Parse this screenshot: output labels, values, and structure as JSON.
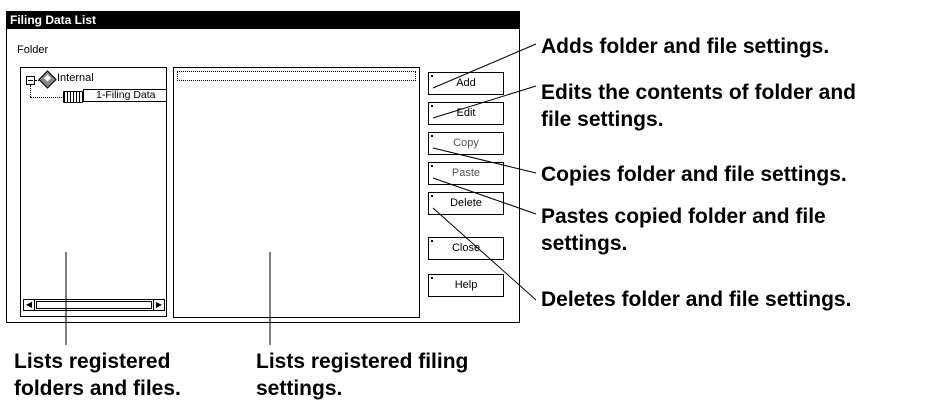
{
  "dialog": {
    "title": "Filing Data List",
    "folder_label": "Folder",
    "tree": {
      "root_label": "Internal",
      "child_label": "1-Filing Data"
    },
    "buttons": {
      "add": "Add",
      "edit": "Edit",
      "copy": "Copy",
      "paste": "Paste",
      "delete": "Delete",
      "close": "Close",
      "help": "Help"
    }
  },
  "callouts": {
    "add": "Adds folder and file settings.",
    "edit": "Edits the contents of folder and\nfile settings.",
    "copy": "Copies folder and file settings.",
    "paste": "Pastes copied folder and file\nsettings.",
    "delete": "Deletes folder and file settings.",
    "tree": "Lists registered\nfolders and files.",
    "list": "Lists registered filing\nsettings."
  }
}
